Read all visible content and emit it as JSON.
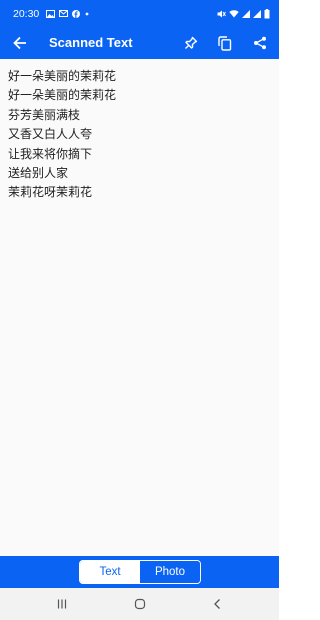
{
  "status_bar": {
    "time": "20:30",
    "left_icons": [
      "gallery-icon",
      "gmail-icon",
      "facebook-icon",
      "dot-icon"
    ],
    "right_icons": [
      "mute-icon",
      "wifi-icon",
      "signal-icon",
      "signal-icon",
      "battery-icon"
    ]
  },
  "app_bar": {
    "title": "Scanned Text",
    "icons": [
      "back-arrow-icon",
      "pin-icon",
      "copy-icon",
      "share-icon"
    ]
  },
  "scanned_text": {
    "lines": [
      "好一朵美丽的茉莉花",
      "好一朵美丽的茉莉花",
      "芬芳美丽满枝",
      "又香又白人人夸",
      "让我来将你摘下",
      "送给别人家",
      "茉莉花呀茉莉花"
    ]
  },
  "tabs": {
    "text_label": "Text",
    "photo_label": "Photo",
    "selected": "Text"
  },
  "nav_bar": {
    "icons": [
      "recents-icon",
      "home-icon",
      "back-icon"
    ]
  },
  "colors": {
    "primary": "#0a63f3",
    "content_background": "#fafafa",
    "text": "#202020",
    "nav_background": "#f2f2f2"
  }
}
